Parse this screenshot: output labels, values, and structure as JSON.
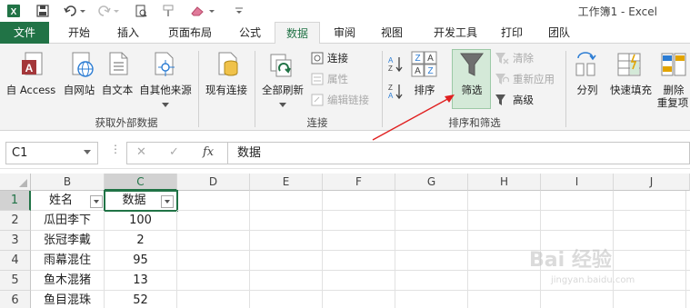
{
  "titlebar": {
    "app_title": "工作簿1 - Excel",
    "undo_icon": "undo-icon",
    "redo_icon": "redo-icon"
  },
  "tabs": [
    {
      "label": "文件"
    },
    {
      "label": "开始"
    },
    {
      "label": "插入"
    },
    {
      "label": "页面布局"
    },
    {
      "label": "公式"
    },
    {
      "label": "数据"
    },
    {
      "label": "审阅"
    },
    {
      "label": "视图"
    },
    {
      "label": "开发工具"
    },
    {
      "label": "打印"
    },
    {
      "label": "团队"
    }
  ],
  "ribbon": {
    "external": {
      "access": "自 Access",
      "web": "自网站",
      "text": "自文本",
      "other": "自其他来源",
      "label": "获取外部数据"
    },
    "existing": "现有连接",
    "connections": {
      "refresh": "全部刷新",
      "connect": "连接",
      "properties": "属性",
      "edit_links": "编辑链接",
      "label": "连接"
    },
    "sort_filter": {
      "sort": "排序",
      "filter": "筛选",
      "clear": "清除",
      "reapply": "重新应用",
      "advanced": "高级",
      "label": "排序和筛选"
    },
    "tools": {
      "split": "分列",
      "flash_fill": "快速填充",
      "remove_dup": "删除",
      "remove_dup_2": "重复项"
    }
  },
  "formula_bar": {
    "name_box": "C1",
    "cancel": "✕",
    "enter": "✓",
    "fx": "fx",
    "content": "数据"
  },
  "grid": {
    "columns": [
      "B",
      "C",
      "D",
      "E",
      "F",
      "G",
      "H",
      "I",
      "J"
    ],
    "rows": [
      "1",
      "2",
      "3",
      "4",
      "5",
      "6"
    ],
    "cells": [
      [
        "姓名",
        "数据"
      ],
      [
        "瓜田李下",
        "100"
      ],
      [
        "张冠李戴",
        "2"
      ],
      [
        "雨幕混住",
        "95"
      ],
      [
        "鱼木混猪",
        "13"
      ],
      [
        "鱼目混珠",
        "52"
      ]
    ]
  },
  "watermark": {
    "main": "Bai 经验",
    "sub": "jingyan.baidu.com"
  },
  "colors": {
    "accent": "#217346",
    "arrow": "#e02020"
  }
}
